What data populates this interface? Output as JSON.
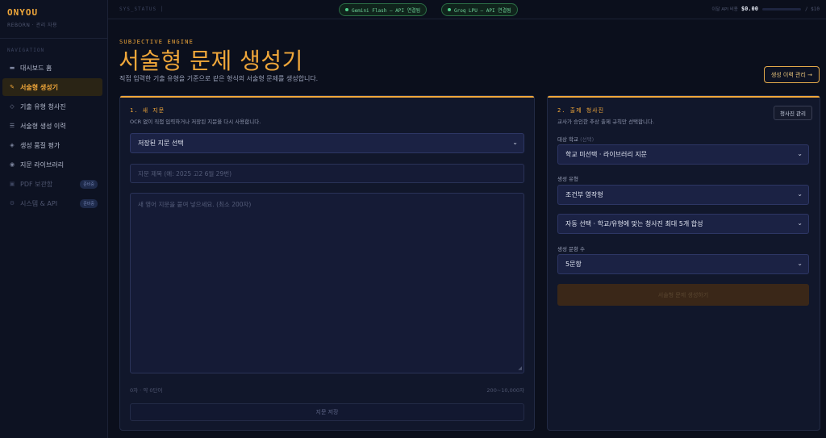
{
  "brand": {
    "name": "ONYOU",
    "subtitle": "REBORN · 관리 자용"
  },
  "sidebar": {
    "section_label": "NAVIGATION",
    "items": [
      {
        "label": "대시보드 홈",
        "icon": "dashboard-icon",
        "glyph": "▬"
      },
      {
        "label": "서술형 생성기",
        "icon": "pencil-icon",
        "glyph": "✎"
      },
      {
        "label": "기출 유형 청사진",
        "icon": "diamond-icon",
        "glyph": "◇"
      },
      {
        "label": "서술형 생성 이력",
        "icon": "list-icon",
        "glyph": "☰"
      },
      {
        "label": "생성 품질 평가",
        "icon": "sparkle-icon",
        "glyph": "◈"
      },
      {
        "label": "지문 라이브러리",
        "icon": "library-icon",
        "glyph": "◉"
      },
      {
        "label": "PDF 보관함",
        "icon": "archive-icon",
        "glyph": "▣",
        "badge": "준비중"
      },
      {
        "label": "시스템 & API",
        "icon": "gear-icon",
        "glyph": "⚙",
        "badge": "준비중"
      }
    ]
  },
  "topbar": {
    "status_label": "SYS_STATUS │",
    "apis": [
      {
        "label": "Gemini Flash — API 연결됨"
      },
      {
        "label": "Groq LPU — API 연결됨"
      }
    ],
    "cost_label": "이달 API 비용",
    "cost_amount": "$0.00",
    "cost_limit": "/ $10",
    "cost_usage_fraction": 0
  },
  "header": {
    "eyebrow": "SUBJECTIVE ENGINE",
    "title": "서술형 문제 생성기",
    "description": "직접 입력한 기출 유형을 기준으로 같은 형식의 서술형 문제를 생성합니다.",
    "history_button": "생성 이력 관리 →"
  },
  "left_panel": {
    "title": "1. 새 지문",
    "subtitle": "OCR 없이 직접 입력하거나 저장된 지문을 다시 사용합니다.",
    "saved_select_value": "저장된 지문 선택",
    "title_input_placeholder": "지문 제목 (예: 2025 고2 6월 29번)",
    "body_placeholder": "새 영어 지문을 붙여 넣으세요. (최소 200자)",
    "char_count": "0자 · 약 0단어",
    "char_range": "200~10,000자",
    "save_button": "지문 저장"
  },
  "right_panel": {
    "title": "2. 출제 청사진",
    "subtitle": "교사가 승인한 추상 출제 규칙만 선택합니다.",
    "manage_button": "청사진 관리",
    "school_label": "대상 학교",
    "school_label_optional": "(선택)",
    "school_value": "학교 미선택 · 라이브러리 지문",
    "type_label": "생성 유형",
    "type_value": "조건부 영작형",
    "blueprint_value": "자동 선택 · 학교/유형에 맞는 청사진 최대 5개 합성",
    "count_label": "생성 문항 수",
    "count_value": "5문항",
    "generate_button": "서술형 문제 생성하기"
  }
}
